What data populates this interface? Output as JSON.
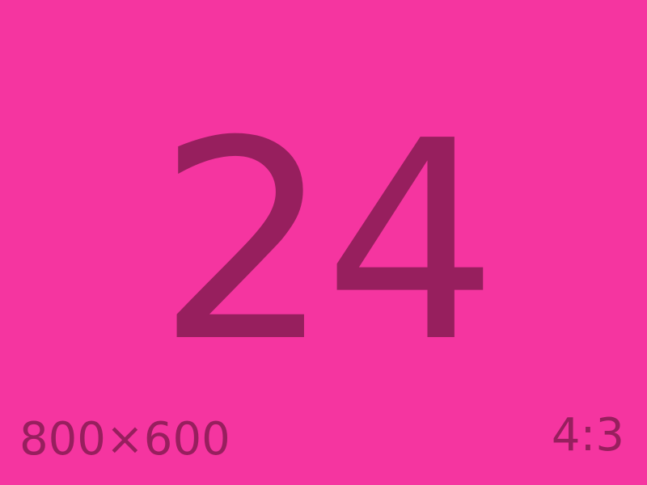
{
  "main": {
    "number": "24",
    "dimensions": "800×600",
    "aspect_ratio": "4:3"
  },
  "colors": {
    "background": "#f535a0",
    "text": "#971f5e"
  }
}
